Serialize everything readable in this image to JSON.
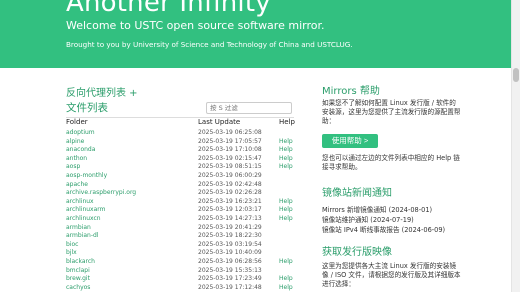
{
  "header": {
    "title": "Another Infinity",
    "subtitle": "Welcome to USTC open source software mirror.",
    "tagline": "Brought to you by University of Science and Technology of China and USTCLUG."
  },
  "main": {
    "proxy_link": "反向代理列表 +",
    "file_list_heading": "文件列表",
    "filter_placeholder": "按 S 过滤",
    "columns": {
      "folder": "Folder",
      "updated": "Last Update",
      "help": "Help"
    },
    "rows": [
      {
        "name": "adoptium",
        "date": "2025-03-19 06:25:08",
        "help": ""
      },
      {
        "name": "alpine",
        "date": "2025-03-19 17:05:57",
        "help": "Help"
      },
      {
        "name": "anaconda",
        "date": "2025-03-19 17:10:08",
        "help": "Help"
      },
      {
        "name": "anthon",
        "date": "2025-03-19 02:15:47",
        "help": "Help"
      },
      {
        "name": "aosp",
        "date": "2025-03-19 08:51:15",
        "help": "Help"
      },
      {
        "name": "aosp-monthly",
        "date": "2025-03-19 06:00:29",
        "help": ""
      },
      {
        "name": "apache",
        "date": "2025-03-19 02:42:48",
        "help": ""
      },
      {
        "name": "archive.raspberrypi.org",
        "date": "2025-03-19 02:26:28",
        "help": ""
      },
      {
        "name": "archlinux",
        "date": "2025-03-19 16:23:21",
        "help": "Help"
      },
      {
        "name": "archlinuxarm",
        "date": "2025-03-19 12:03:17",
        "help": "Help"
      },
      {
        "name": "archlinuxcn",
        "date": "2025-03-19 14:27:13",
        "help": "Help"
      },
      {
        "name": "armbian",
        "date": "2025-03-19 20:41:29",
        "help": ""
      },
      {
        "name": "armbian-dl",
        "date": "2025-03-19 18:22:30",
        "help": ""
      },
      {
        "name": "bioc",
        "date": "2025-03-19 03:19:54",
        "help": ""
      },
      {
        "name": "bjlx",
        "date": "2025-03-19 10:40:09",
        "help": ""
      },
      {
        "name": "blackarch",
        "date": "2025-03-19 06:28:56",
        "help": "Help"
      },
      {
        "name": "bmclapi",
        "date": "2025-03-19 15:35:13",
        "help": ""
      },
      {
        "name": "brew.git",
        "date": "2025-03-19 17:23:49",
        "help": "Help"
      },
      {
        "name": "cachyos",
        "date": "2025-03-19 17:12:48",
        "help": "Help"
      }
    ]
  },
  "sidebar": {
    "mirrors_help_title": "Mirrors 帮助",
    "mirrors_help_text": "如果您不了解如何配置 Linux 发行版 / 软件的安装源，这里为您提供了主流发行版的源配置帮助：",
    "help_button": "使用帮助 >",
    "help_note": "您也可以通过左边的文件列表中相应的 Help 链接寻求帮助。",
    "news_title": "镜像站新闻通知",
    "news": [
      "Mirrors 新增镜像通知 (2024-08-01)",
      "镜像站维护通知 (2024-07-19)",
      "镜像站 IPv4 断线事故报告 (2024-06-09)"
    ],
    "iso_title": "获取发行版映像",
    "iso_text": "这里为您提供各大主流 Linux 发行版的安装镜像 / ISO 文件，请根据您的发行版及其详细版本进行选择："
  },
  "colors": {
    "accent": "#32c080",
    "link": "#2a9d6a"
  }
}
